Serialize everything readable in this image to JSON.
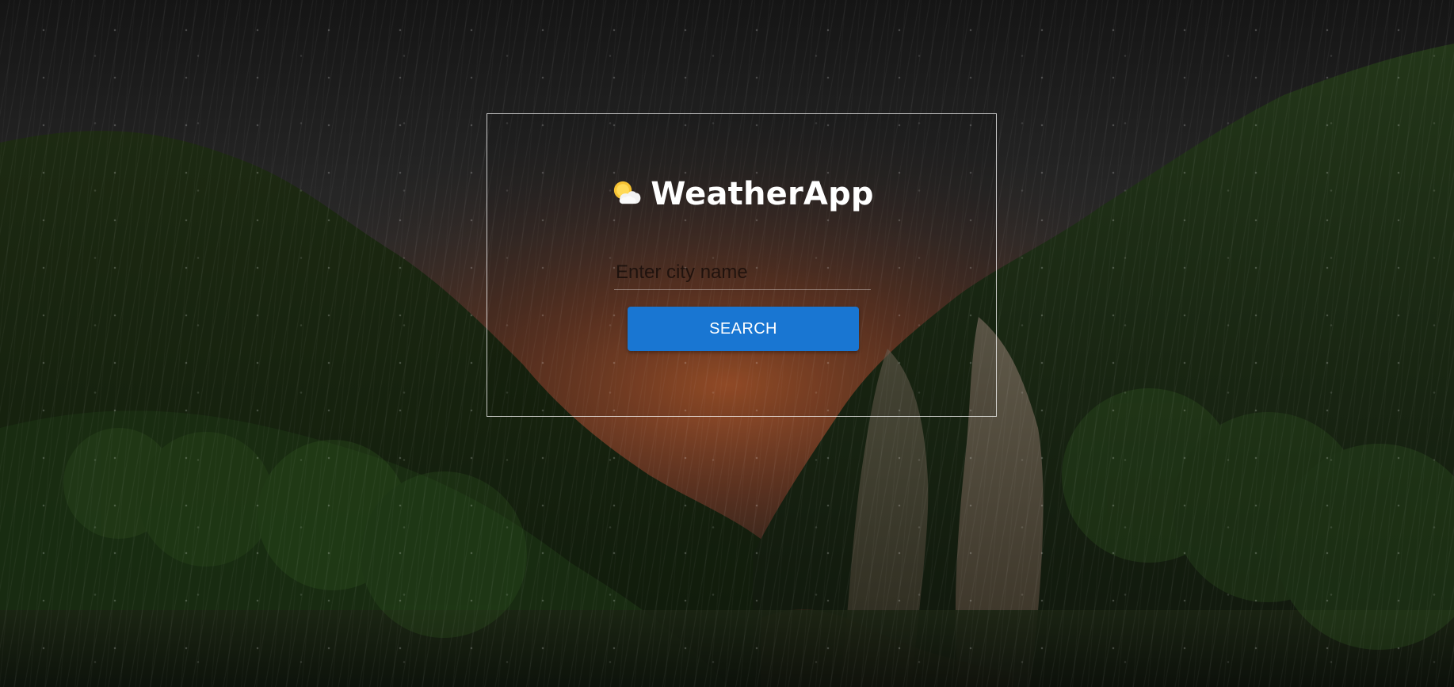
{
  "app": {
    "title": "WeatherApp",
    "icon": "sun-behind-cloud-icon"
  },
  "search": {
    "placeholder": "Enter city name",
    "value": "",
    "button_label": "SEARCH"
  },
  "colors": {
    "button_bg": "#1976d2",
    "title_text": "#ffffff",
    "card_border": "#ffffff"
  }
}
